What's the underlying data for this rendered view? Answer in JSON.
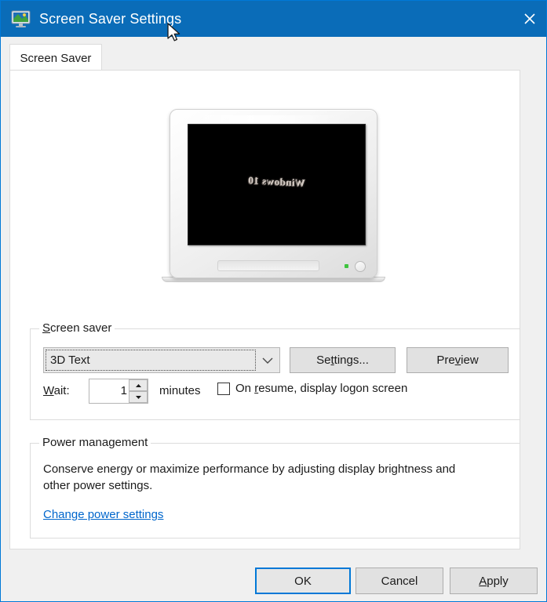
{
  "window": {
    "title": "Screen Saver Settings",
    "icon": "display-monitor-icon",
    "close_label": "×",
    "accent_color": "#0078d7",
    "titlebar_color": "#0a6cb8",
    "dialog_background": "#f0f0f0"
  },
  "tabs": [
    {
      "label": "Screen Saver",
      "selected": true
    }
  ],
  "preview": {
    "screensaver_text": "Windows 10",
    "screen_color": "#000000",
    "led_color": "#3ec43e"
  },
  "screen_saver_group": {
    "legend_prefix": "",
    "legend_accel": "S",
    "legend_suffix": "creen saver",
    "combo": {
      "value": "3D Text",
      "arrow_icon": "chevron-down-icon"
    },
    "settings_button": {
      "prefix": "Se",
      "accel": "t",
      "suffix": "tings..."
    },
    "preview_button": {
      "prefix": "Pre",
      "accel": "v",
      "suffix": "iew"
    },
    "wait": {
      "label_accel": "W",
      "label_suffix": "ait:",
      "value": "1",
      "unit_label": "minutes",
      "spin_up_icon": "triangle-up-icon",
      "spin_down_icon": "triangle-down-icon"
    },
    "logon_checkbox": {
      "checked": false,
      "prefix": "On ",
      "accel": "r",
      "suffix": "esume, display logon screen"
    }
  },
  "power_group": {
    "legend": "Power management",
    "description": "Conserve energy or maximize performance by adjusting display brightness and other power settings.",
    "link": "Change power settings",
    "link_color": "#0066cc"
  },
  "footer": {
    "ok_label": "OK",
    "cancel_label": "Cancel",
    "apply": {
      "accel": "A",
      "suffix": "pply"
    }
  }
}
